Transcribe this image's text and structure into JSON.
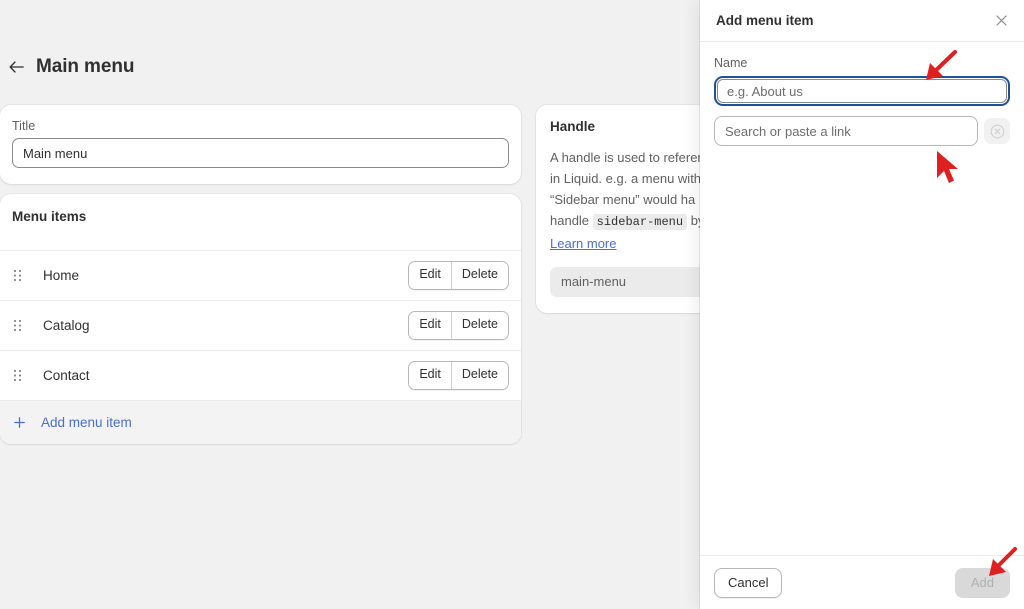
{
  "page": {
    "title": "Main menu",
    "back_icon": "arrow-left-icon"
  },
  "title_card": {
    "label": "Title",
    "value": "Main menu",
    "placeholder": ""
  },
  "menu_items_card": {
    "heading": "Menu items",
    "rows": [
      {
        "label": "Home",
        "edit": "Edit",
        "delete": "Delete"
      },
      {
        "label": "Catalog",
        "edit": "Edit",
        "delete": "Delete"
      },
      {
        "label": "Contact",
        "edit": "Edit",
        "delete": "Delete"
      }
    ],
    "add_label": "Add menu item",
    "add_icon": "plus-icon"
  },
  "handle_card": {
    "heading": "Handle",
    "description_1": "A handle is used to reference",
    "description_2": "in Liquid. e.g. a menu with",
    "description_3": "“Sidebar menu” would ha",
    "description_4_pre": "handle ",
    "description_4_code": "sidebar-menu",
    "description_4_post": " by",
    "learn_more": "Learn more",
    "value": "main-menu"
  },
  "modal": {
    "title": "Add menu item",
    "close_icon": "close-icon",
    "name_label": "Name",
    "name_value": "",
    "name_placeholder": "e.g. About us",
    "link_value": "",
    "link_placeholder": "Search or paste a link",
    "clear_icon": "circle-x-icon",
    "cancel_label": "Cancel",
    "add_label": "Add",
    "add_disabled": true
  },
  "annotations": {
    "arrow_color": "#e02020",
    "items": [
      {
        "name": "arrow-to-name-field",
        "kind": "arrow-down-left"
      },
      {
        "name": "cursor-at-link-field",
        "kind": "cursor-up-left"
      },
      {
        "name": "arrow-to-add-button",
        "kind": "arrow-down-left"
      }
    ]
  },
  "colors": {
    "background": "#f1f1f1",
    "card": "#ffffff",
    "text": "#303030",
    "muted": "#616161",
    "link": "#4a6ed3",
    "focus_ring": "#1f5199",
    "annotation": "#e02020"
  }
}
